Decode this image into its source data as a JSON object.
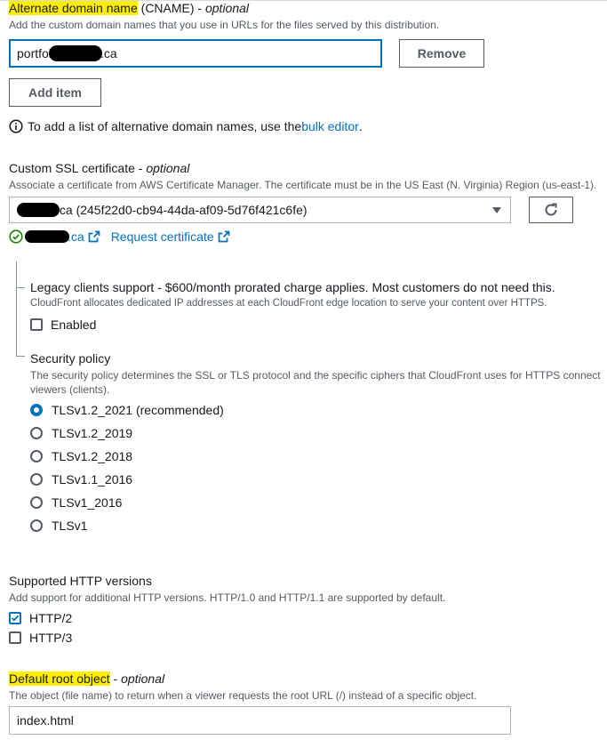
{
  "cname": {
    "label": "Alternate domain name",
    "label_rest": " (CNAME) - ",
    "optional": "optional",
    "description": "Add the custom domain names that you use in URLs for the files served by this distribution.",
    "items": [
      {
        "value_start": "portfoli",
        "value_end": ".ca",
        "remove_label": "Remove"
      }
    ],
    "add_item_label": "Add item",
    "info_text": "To add a list of alternative domain names, use the ",
    "bulk_editor_link": "bulk editor",
    "info_end": "."
  },
  "ssl": {
    "label": "Custom SSL certificate - ",
    "optional": "optional",
    "description": "Associate a certificate from AWS Certificate Manager. The certificate must be in the US East (N. Virginia) Region (us-east-1).",
    "selected_value": ".ca (245f22d0-cb94-44da-af09-5d76f421c6fe)",
    "cert_link_suffix": ".ca",
    "request_link": "Request certificate"
  },
  "legacy": {
    "label": "Legacy clients support - $600/month prorated charge applies. Most customers do not need this.",
    "description": "CloudFront allocates dedicated IP addresses at each CloudFront edge location to serve your content over HTTPS.",
    "checkbox_label": "Enabled",
    "checked": false
  },
  "security_policy": {
    "label": "Security policy",
    "description_line1": "The security policy determines the SSL or TLS protocol and the specific ciphers that CloudFront uses for HTTPS connect",
    "description_line2": "viewers (clients).",
    "options": [
      {
        "label": "TLSv1.2_2021 (recommended)",
        "selected": true
      },
      {
        "label": "TLSv1.2_2019",
        "selected": false
      },
      {
        "label": "TLSv1.2_2018",
        "selected": false
      },
      {
        "label": "TLSv1.1_2016",
        "selected": false
      },
      {
        "label": "TLSv1_2016",
        "selected": false
      },
      {
        "label": "TLSv1",
        "selected": false
      }
    ]
  },
  "http_versions": {
    "label": "Supported HTTP versions",
    "description": "Add support for additional HTTP versions. HTTP/1.0 and HTTP/1.1 are supported by default.",
    "options": [
      {
        "label": "HTTP/2",
        "checked": true
      },
      {
        "label": "HTTP/3",
        "checked": false
      }
    ]
  },
  "root_object": {
    "label": "Default root object",
    "label_rest": " - ",
    "optional": "optional",
    "description": "The object (file name) to return when a viewer requests the root URL (/) instead of a specific object.",
    "value": "index.html"
  },
  "colors": {
    "accent": "#0073bb",
    "highlight": "#ffee00",
    "success": "#1d8102"
  }
}
